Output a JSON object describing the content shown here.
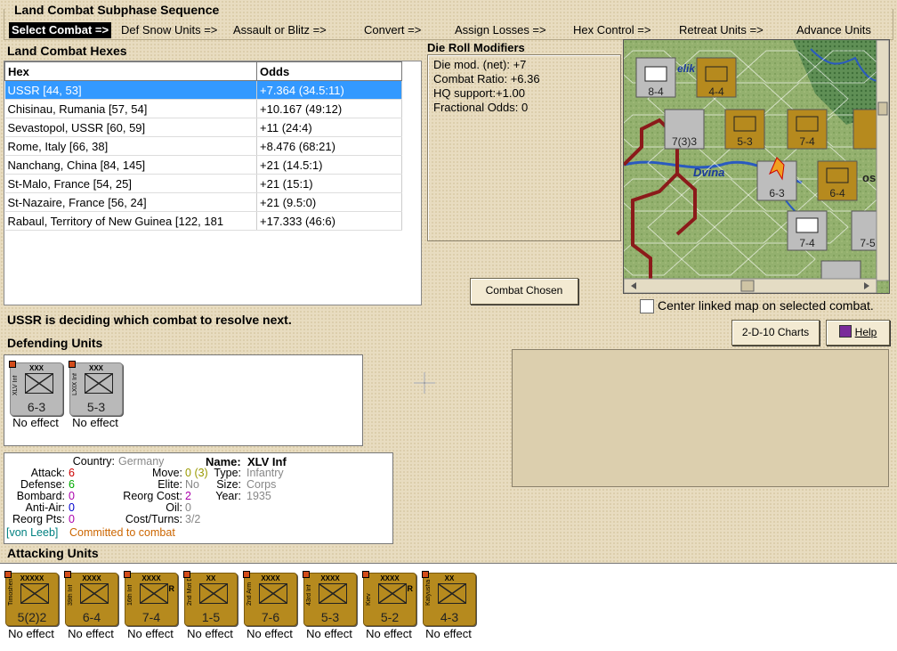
{
  "phase": {
    "title": "Land Combat Subphase Sequence",
    "steps": [
      "Select Combat =>",
      "Def Snow Units =>",
      "Assault or Blitz =>",
      "Convert =>",
      "Assign Losses =>",
      "Hex Control =>",
      "Retreat Units =>",
      "Advance Units"
    ]
  },
  "hexes": {
    "title": "Land Combat Hexes",
    "headers": [
      "Hex",
      "Odds"
    ],
    "rows": [
      {
        "hex": "USSR [44, 53]",
        "odds": "+7.364 (34.5:11)"
      },
      {
        "hex": "Chisinau, Rumania [57, 54]",
        "odds": "+10.167 (49:12)"
      },
      {
        "hex": "Sevastopol, USSR [60, 59]",
        "odds": "+11 (24:4)"
      },
      {
        "hex": "Rome, Italy [66, 38]",
        "odds": "+8.476 (68:21)"
      },
      {
        "hex": "Nanchang, China [84, 145]",
        "odds": "+21 (14.5:1)"
      },
      {
        "hex": "St-Malo, France [54, 25]",
        "odds": "+21 (15:1)"
      },
      {
        "hex": "St-Nazaire, France [56, 24]",
        "odds": "+21 (9.5:0)"
      },
      {
        "hex": "Rabaul, Territory of New Guinea [122, 181",
        "odds": "+17.333 (46:6)"
      }
    ]
  },
  "drm": {
    "title": "Die Roll Modifiers",
    "lines": [
      "Die mod. (net): +7",
      "",
      "Combat Ratio: +6.36",
      "HQ support:+1.00",
      "Fractional Odds: 0"
    ]
  },
  "map": {
    "river_label": "Dvina",
    "city_fragment": "elik",
    "city_fragment2": "osl"
  },
  "buttons": {
    "combat_chosen": "Combat Chosen",
    "charts": "2-D-10 Charts",
    "help": "Help"
  },
  "center_label": "Center linked map on selected combat.",
  "status_msg": "USSR is deciding which combat to resolve next.",
  "defending": {
    "title": "Defending Units",
    "units": [
      {
        "size": "XXX",
        "name": "XLV Inf",
        "strength": "6-3",
        "effect": "No effect"
      },
      {
        "size": "XXX",
        "name": "LXIX Inf",
        "strength": "5-3",
        "effect": "No effect"
      }
    ]
  },
  "unit_info": {
    "country_label": "Country:",
    "country": "Germany",
    "attack_label": "Attack:",
    "attack": "6",
    "defense_label": "Defense:",
    "defense": "6",
    "bombard_label": "Bombard:",
    "bombard": "0",
    "antiair_label": "Anti-Air:",
    "antiair": "0",
    "reorgpts_label": "Reorg Pts:",
    "reorgpts": "0",
    "move_label": "Move:",
    "move": "0",
    "move_extra": "(3)",
    "elite_label": "Elite:",
    "elite": "No",
    "reorgcost_label": "Reorg Cost:",
    "reorgcost": "2",
    "oil_label": "Oil:",
    "oil": "0",
    "costturns_label": "Cost/Turns:",
    "costturns": "3/2",
    "name_label": "Name:",
    "name": "XLV Inf",
    "type_label": "Type:",
    "type": "Infantry",
    "size_label": "Size:",
    "size": "Corps",
    "year_label": "Year:",
    "year": "1935",
    "hq": "[von Leeb]",
    "committed": "Committed to combat"
  },
  "attacking": {
    "title": "Attacking Units",
    "units": [
      {
        "size": "XXXXX",
        "name": "Timoshenko",
        "strength": "5(2)2",
        "res": "",
        "effect": "No effect"
      },
      {
        "size": "XXXX",
        "name": "39th Inf",
        "strength": "6-4",
        "res": "",
        "effect": "No effect"
      },
      {
        "size": "XXXX",
        "name": "16th Inf",
        "strength": "7-4",
        "res": "R",
        "effect": "No effect"
      },
      {
        "size": "XX",
        "name": "2nd Mot Div",
        "strength": "1-5",
        "res": "",
        "effect": "No effect"
      },
      {
        "size": "XXXX",
        "name": "2nd Arm",
        "strength": "7-6",
        "res": "",
        "effect": "No effect"
      },
      {
        "size": "XXXX",
        "name": "43rd Inf",
        "strength": "5-3",
        "res": "",
        "effect": "No effect"
      },
      {
        "size": "XXXX",
        "name": "Kiev",
        "strength": "5-2",
        "res": "R",
        "effect": "No effect"
      },
      {
        "size": "XX",
        "name": "Katyusha",
        "strength": "4-3",
        "res": "",
        "effect": "No effect"
      }
    ]
  },
  "colors": {
    "select_bg": "#3399ff",
    "soviet_tan": "#b68a1e",
    "german_gray": "#b9b9b9",
    "attack_red": "#cc0000",
    "defense_green": "#00aa00",
    "bombard_purple": "#aa00aa",
    "committed_orange": "#cc6600",
    "hq_teal": "#008080"
  }
}
